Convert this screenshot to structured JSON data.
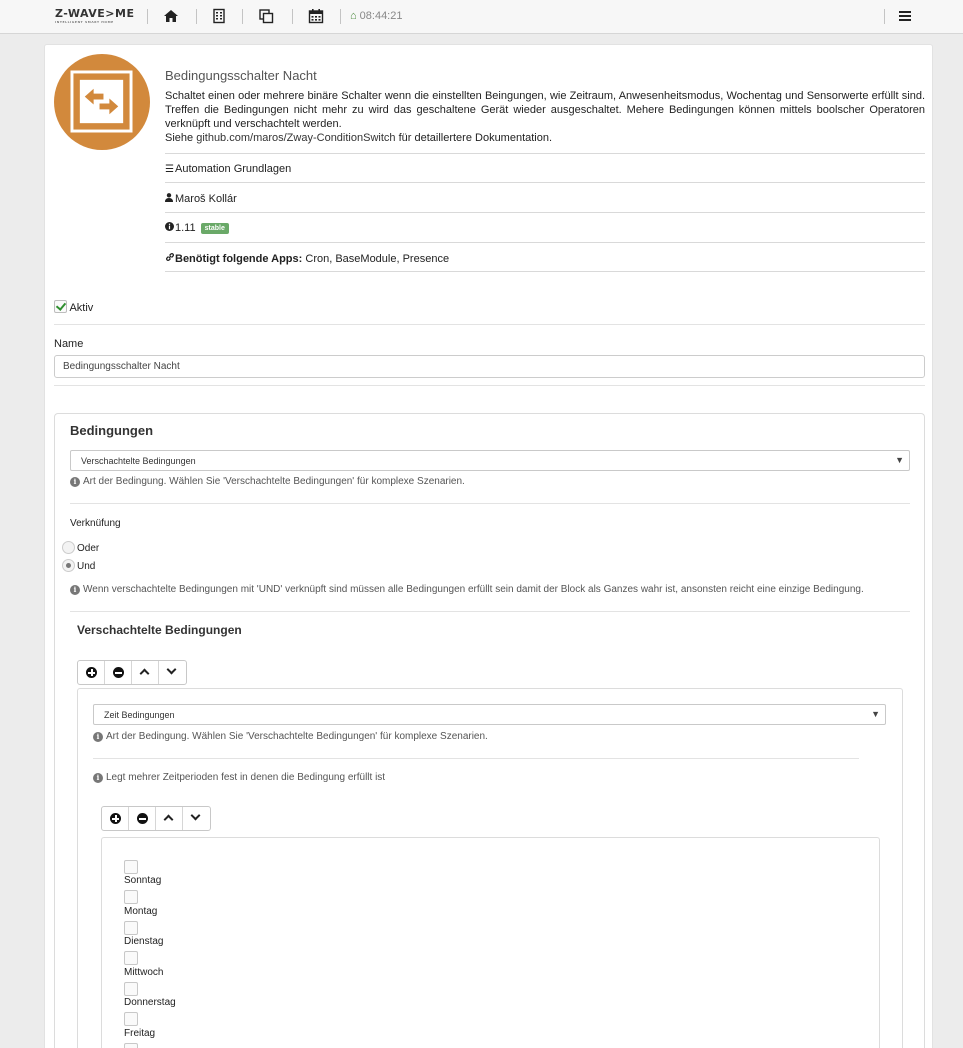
{
  "topbar": {
    "logo": "Z-WAVE>ME",
    "logo_sub": "INTELLIGENT SMART HOME",
    "time": "08:44:21",
    "icons": [
      "home-icon",
      "building-icon",
      "copy-icon",
      "calendar-icon",
      "menu-icon"
    ]
  },
  "app": {
    "title": "Bedingungsschalter Nacht",
    "description": "Schaltet einen oder mehrere binäre Schalter wenn die einstellten Beingungen, wie Zeitraum, Anwesenheitsmodus, Wochentag und Sensorwerte erfüllt sind. Treffen die Bedingungen nicht mehr zu wird das geschaltene Gerät wieder ausgeschaltet. Mehere Bedingungen können mittels boolscher Operatoren verknüpft und verschachtelt werden.",
    "link_prefix": "Siehe",
    "link_url": "github.com/maros/Zway-ConditionSwitch",
    "link_suffix": "für detaillertere Dokumentation.",
    "category": "Automation Grundlagen",
    "author": "Maroš Kollár",
    "version": "1.11",
    "badge": "stable",
    "dependencies_label": "Benötigt folgende Apps:",
    "dependencies": "Cron, BaseModule, Presence"
  },
  "form": {
    "active_label": "Aktiv",
    "active_checked": true,
    "name_label": "Name",
    "name_value": "Bedingungsschalter Nacht"
  },
  "conditions": {
    "heading": "Bedingungen",
    "type_selected": "Verschachtelte Bedingungen",
    "type_help": "Art der Bedingung. Wählen Sie 'Verschachtelte Bedingungen' für komplexe Szenarien.",
    "logic_label": "Verknüfung",
    "logic_options": [
      "Oder",
      "Und"
    ],
    "logic_selected": "Und",
    "logic_help": "Wenn verschachtelte Bedingungen mit 'UND' verknüpft sind müssen alle Bedingungen erfüllt sein damit der Block als Ganzes wahr ist, ansonsten reicht eine einzige Bedingung.",
    "nested_heading": "Verschachtelte Bedingungen",
    "nested": {
      "type_selected": "Zeit Bedingungen",
      "type_help": "Art der Bedingung. Wählen Sie 'Verschachtelte Bedingungen' für komplexe Szenarien.",
      "period_help": "Legt mehrer Zeitperioden fest in denen die Bedingung erfüllt ist",
      "days": [
        "Sonntag",
        "Montag",
        "Dienstag",
        "Mittwoch",
        "Donnerstag",
        "Freitag"
      ]
    }
  }
}
